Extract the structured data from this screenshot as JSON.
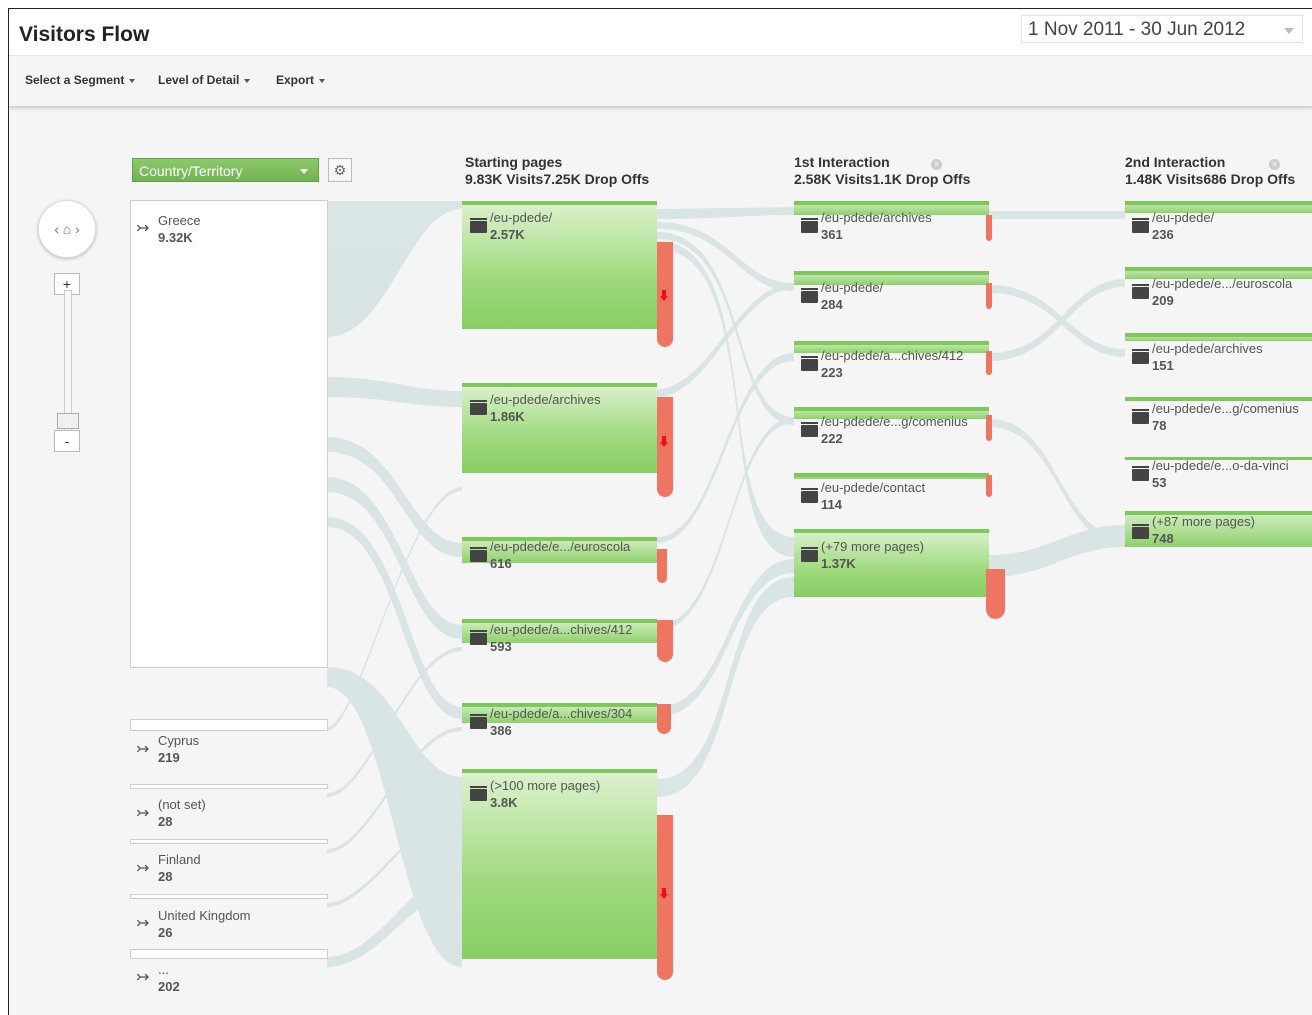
{
  "header": {
    "title": "Visitors Flow",
    "date_range": "1 Nov 2011 - 30 Jun 2012"
  },
  "toolbar": {
    "segment": "Select a Segment",
    "detail": "Level of Detail",
    "export": "Export"
  },
  "dimension": {
    "selected": "Country/Territory"
  },
  "columns": [
    {
      "title": "Starting pages",
      "stats": "9.83K Visits7.25K Drop Offs"
    },
    {
      "title": "1st Interaction",
      "stats": "2.58K Visits1.1K Drop Offs"
    },
    {
      "title": "2nd Interaction",
      "stats": "1.48K Visits686 Drop Offs"
    }
  ],
  "countries": [
    {
      "name": "Greece",
      "count": "9.32K"
    },
    {
      "name": "Cyprus",
      "count": "219"
    },
    {
      "name": "(not set)",
      "count": "28"
    },
    {
      "name": "Finland",
      "count": "28"
    },
    {
      "name": "United Kingdom",
      "count": "26"
    },
    {
      "name": "...",
      "count": "202"
    }
  ],
  "starting_pages": [
    {
      "name": "/eu-pdede/",
      "count": "2.57K"
    },
    {
      "name": "/eu-pdede/archives",
      "count": "1.86K"
    },
    {
      "name": "/eu-pdede/e.../euroscola",
      "count": "616"
    },
    {
      "name": "/eu-pdede/a...chives/412",
      "count": "593"
    },
    {
      "name": "/eu-pdede/a...chives/304",
      "count": "386"
    },
    {
      "name": "(>100 more pages)",
      "count": "3.8K"
    }
  ],
  "first_interaction": [
    {
      "name": "/eu-pdede/archives",
      "count": "361"
    },
    {
      "name": "/eu-pdede/",
      "count": "284"
    },
    {
      "name": "/eu-pdede/a...chives/412",
      "count": "223"
    },
    {
      "name": "/eu-pdede/e...g/comenius",
      "count": "222"
    },
    {
      "name": "/eu-pdede/contact",
      "count": "114"
    },
    {
      "name": "(+79 more pages)",
      "count": "1.37K"
    }
  ],
  "second_interaction": [
    {
      "name": "/eu-pdede/",
      "count": "236"
    },
    {
      "name": "/eu-pdede/e.../euroscola",
      "count": "209"
    },
    {
      "name": "/eu-pdede/archives",
      "count": "151"
    },
    {
      "name": "/eu-pdede/e...g/comenius",
      "count": "78"
    },
    {
      "name": "/eu-pdede/e...o-da-vinci",
      "count": "53"
    },
    {
      "name": "(+87 more pages)",
      "count": "748"
    }
  ],
  "colors": {
    "node_green": "#8ed16b",
    "drop_red": "#ef7563",
    "flow": "#d4e3e3"
  }
}
